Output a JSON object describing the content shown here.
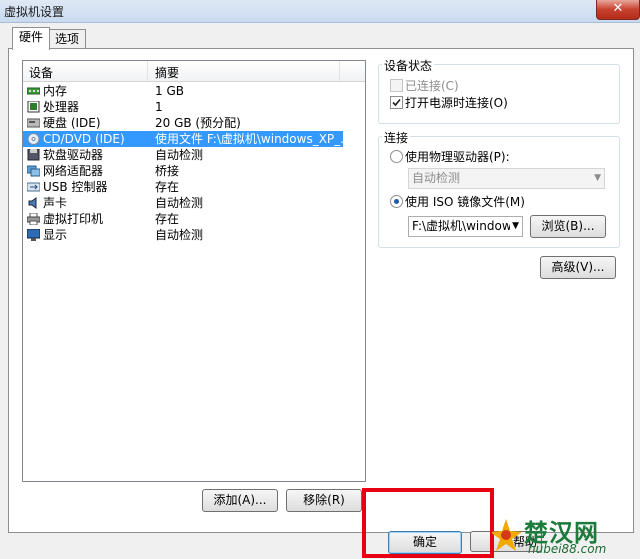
{
  "window": {
    "title": "虚拟机设置",
    "close_glyph": "✕"
  },
  "tabs": [
    {
      "label": "硬件"
    },
    {
      "label": "选项"
    }
  ],
  "device_list": {
    "col_device": "设备",
    "col_summary": "摘要",
    "rows": [
      {
        "device": "内存",
        "summary": "1 GB",
        "icon": "memory-icon"
      },
      {
        "device": "处理器",
        "summary": "1",
        "icon": "cpu-icon"
      },
      {
        "device": "硬盘 (IDE)",
        "summary": "20 GB (预分配)",
        "icon": "harddisk-icon"
      },
      {
        "device": "CD/DVD (IDE)",
        "summary": "使用文件 F:\\虚拟机\\windows_XP_...",
        "icon": "cd-icon"
      },
      {
        "device": "软盘驱动器",
        "summary": "自动检测",
        "icon": "floppy-icon"
      },
      {
        "device": "网络适配器",
        "summary": "桥接",
        "icon": "network-icon"
      },
      {
        "device": "USB 控制器",
        "summary": "存在",
        "icon": "usb-icon"
      },
      {
        "device": "声卡",
        "summary": "自动检测",
        "icon": "sound-icon"
      },
      {
        "device": "虚拟打印机",
        "summary": "存在",
        "icon": "printer-icon"
      },
      {
        "device": "显示",
        "summary": "自动检测",
        "icon": "display-icon"
      }
    ]
  },
  "buttons": {
    "add": "添加(A)...",
    "remove": "移除(R)",
    "ok": "确定",
    "help": "帮助"
  },
  "device_status": {
    "title": "设备状态",
    "connected": "已连接(C)",
    "connect_on_power": "打开电源时连接(O)"
  },
  "connection": {
    "title": "连接",
    "physical_drive": "使用物理驱动器(P):",
    "physical_drive_value": "自动检测",
    "iso": "使用 ISO 镜像文件(M)",
    "iso_path": "F:\\虚拟机\\windows",
    "browse": "浏览(B)..."
  },
  "advanced_button": "高级(V)...",
  "watermark": {
    "text": "楚汉网",
    "url": "hubei88.com"
  }
}
